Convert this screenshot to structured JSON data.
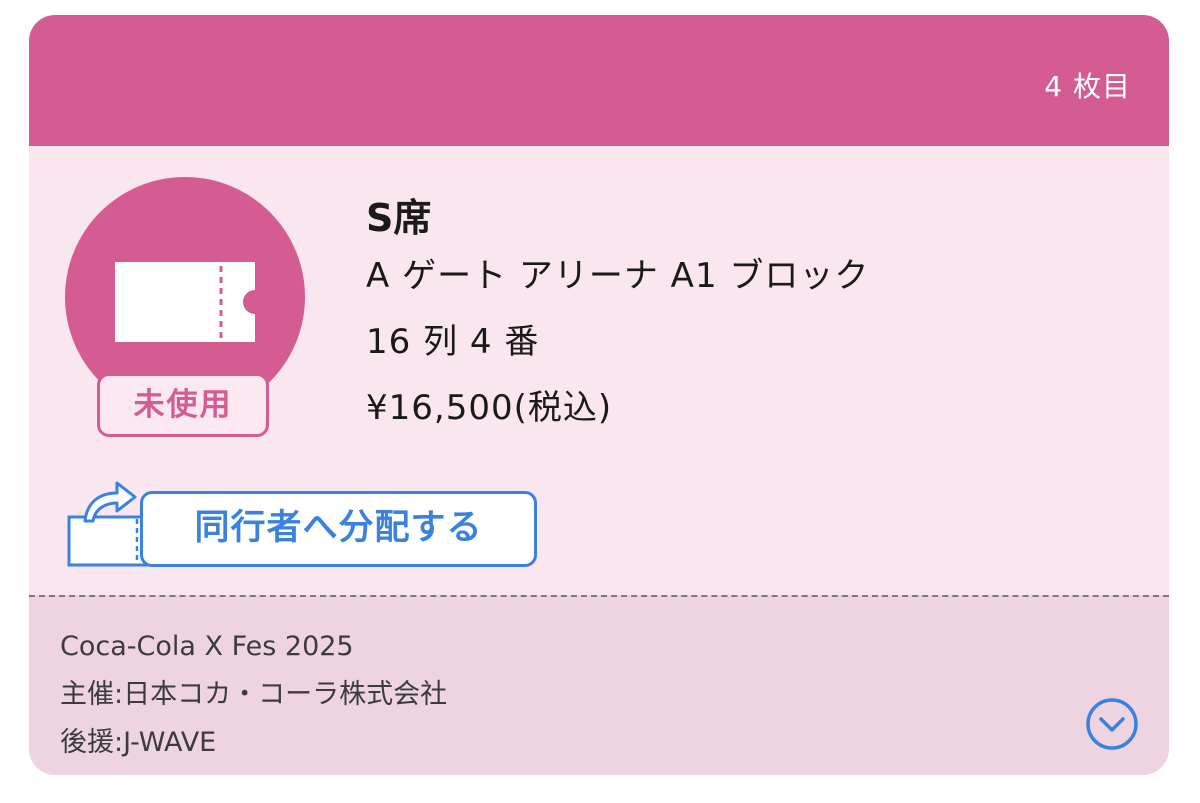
{
  "header": {
    "ticket_count": "4 枚目"
  },
  "ticket": {
    "status": "未使用",
    "seat_class": "S席",
    "location": "A ゲート アリーナ A1 ブロック",
    "seat": "16 列 4 番",
    "price": "¥16,500(税込)"
  },
  "actions": {
    "distribute_label": "同行者へ分配する"
  },
  "event": {
    "name": "Coca-Cola X Fes 2025",
    "organizer": "主催:日本コカ・コーラ株式会社",
    "sponsor": "後援:J-WAVE"
  },
  "icons": {
    "ticket": "ticket-icon",
    "share": "share-ticket-icon",
    "expand": "chevron-down-circle-icon"
  },
  "colors": {
    "accent_pink": "#d45c93",
    "card_bg": "#f9e6ef",
    "footer_bg": "#eed4e1",
    "link_blue": "#3a82df"
  }
}
